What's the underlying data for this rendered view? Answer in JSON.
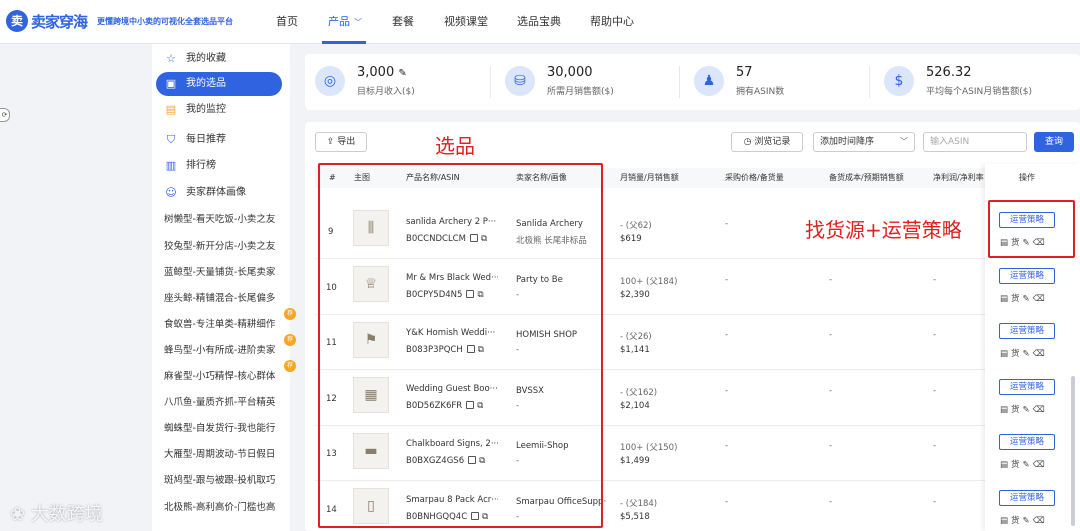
{
  "header": {
    "brand": "卖家穿海",
    "logo_glyph": "卖",
    "slogan": "更懂跨境中小卖的可视化全套选品平台",
    "nav": [
      {
        "label": "首页"
      },
      {
        "label": "产品",
        "active": true
      },
      {
        "label": "套餐"
      },
      {
        "label": "视频课堂"
      },
      {
        "label": "选品宝典"
      },
      {
        "label": "帮助中心"
      }
    ],
    "nav_icon": "chevron-down-icon"
  },
  "sidebar": {
    "items": [
      {
        "label": "我的收藏",
        "icon": "star-icon"
      },
      {
        "label": "我的选品",
        "icon": "cube-icon",
        "active": true
      },
      {
        "label": "我的监控",
        "icon": "monitor-icon"
      },
      {
        "label": "每日推荐",
        "icon": "shield-icon"
      },
      {
        "label": "排行榜",
        "icon": "bar-chart-icon"
      },
      {
        "label": "卖家群体画像",
        "icon": "users-icon"
      }
    ],
    "personas": [
      {
        "label": "树懒型-看天吃饭-小卖之友"
      },
      {
        "label": "狡兔型-新开分店-小卖之友"
      },
      {
        "label": "蓝鲸型-天量铺货-长尾卖家"
      },
      {
        "label": "座头鲸-精铺混合-长尾偏多"
      },
      {
        "label": "食蚁兽-专注单类-精耕细作",
        "badge": "荐"
      },
      {
        "label": "蜂鸟型-小有所成-进阶卖家",
        "badge": "荐"
      },
      {
        "label": "麻雀型-小巧精悍-核心群体",
        "badge": "荐"
      },
      {
        "label": "八爪鱼-量质齐抓-平台精英"
      },
      {
        "label": "蜘蛛型-自发货行-我也能行"
      },
      {
        "label": "大雁型-周期波动-节日假日"
      },
      {
        "label": "斑鸠型-跟与被跟-投机取巧"
      },
      {
        "label": "北极熊-高利高价-门槛也高"
      }
    ]
  },
  "stats": [
    {
      "value": "3,000",
      "label": "目标月收入($)",
      "icon": "target-icon",
      "editable": true
    },
    {
      "value": "30,000",
      "label": "所需月销售额($)",
      "icon": "coins-icon"
    },
    {
      "value": "57",
      "label": "拥有ASIN数",
      "icon": "user-icon"
    },
    {
      "value": "526.32",
      "label": "平均每个ASIN月销售额($)",
      "icon": "money-bag-icon"
    }
  ],
  "toolbar": {
    "export_label": "导出",
    "history_label": "浏览记录",
    "sort_value": "添加时间降序",
    "search_placeholder": "输入ASIN",
    "search_button": "查询"
  },
  "annotations": {
    "title": "选品",
    "right": "找货源+运营策略"
  },
  "table": {
    "columns": [
      "#",
      "主图",
      "产品名称/ASIN",
      "卖家名称/画像",
      "月销量/月销售额",
      "采购价格/备货量",
      "备货成本/预期销售额",
      "净利润/净利率",
      "操作"
    ],
    "rows": [
      {
        "index": "9",
        "name": "sanlida Archery 2 P···",
        "asin": "B0CCNDCLCM",
        "seller": "Sanlida Archery",
        "persona": "北极熊 长尾非标品",
        "sales": "- (父62)",
        "revenue": "$619",
        "purchase": "-",
        "cost": "-",
        "profit": "-"
      },
      {
        "index": "10",
        "name": "Mr & Mrs Black Wed···",
        "asin": "B0CPY5D4N5",
        "seller": "Party to Be",
        "persona": "-",
        "sales": "100+ (父184)",
        "revenue": "$2,390",
        "purchase": "-",
        "cost": "-",
        "profit": "-"
      },
      {
        "index": "11",
        "name": "Y&K Homish Weddi···",
        "asin": "B083P3PQCH",
        "seller": "HOMISH SHOP",
        "persona": "-",
        "sales": "- (父26)",
        "revenue": "$1,141",
        "purchase": "-",
        "cost": "-",
        "profit": "-"
      },
      {
        "index": "12",
        "name": "Wedding Guest Boo···",
        "asin": "B0D56ZK6FR",
        "seller": "BVSSX",
        "persona": "-",
        "sales": "- (父162)",
        "revenue": "$2,104",
        "purchase": "-",
        "cost": "-",
        "profit": "-"
      },
      {
        "index": "13",
        "name": "Chalkboard Signs, 2···",
        "asin": "B0BXGZ4GS6",
        "seller": "Leemii-Shop",
        "persona": "-",
        "sales": "100+ (父150)",
        "revenue": "$1,499",
        "purchase": "-",
        "cost": "-",
        "profit": "-"
      },
      {
        "index": "14",
        "name": "Smarpau 8 Pack Acr···",
        "asin": "B0BNHGQQ4C",
        "seller": "Smarpau OfficeSupp···",
        "persona": "-",
        "sales": "- (父184)",
        "revenue": "$5,518",
        "purchase": "-",
        "cost": "-",
        "profit": "-"
      }
    ],
    "op_button": "运营策略",
    "op_icons": [
      "clipboard-icon",
      "goods-icon",
      "edit-icon",
      "trash-icon"
    ],
    "op_goods_glyph": "货"
  },
  "watermark": "大数跨境",
  "colors": {
    "accent": "#2f63e0",
    "annotation": "#e02020",
    "badge": "#f5a623"
  }
}
